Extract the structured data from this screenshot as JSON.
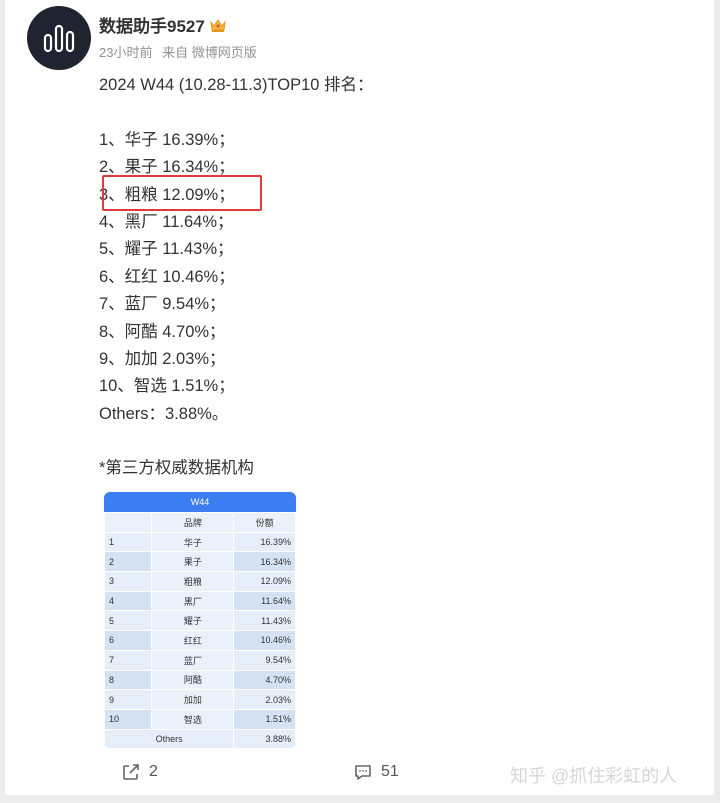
{
  "post": {
    "username": "数据助手9527",
    "meta": {
      "time": "23小时前",
      "source": "来自 微博网页版"
    },
    "heading": "2024 W44 (10.28-11.3)TOP10 排名：",
    "ranking_lines": [
      "1、华子 16.39%；",
      "2、果子 16.34%；",
      "3、粗粮 12.09%；",
      "4、黑厂 11.64%；",
      "5、耀子 11.43%；",
      "6、红红 10.46%；",
      "7、蓝厂 9.54%；",
      "8、阿酷 4.70%；",
      "9、加加 2.03%；",
      "10、智选 1.51%；",
      "Others：3.88%。"
    ],
    "note": "*第三方权威数据机构"
  },
  "table": {
    "title": "W44",
    "headers": [
      "",
      "品牌",
      "份额"
    ],
    "rows": [
      [
        "1",
        "华子",
        "16.39%"
      ],
      [
        "2",
        "果子",
        "16.34%"
      ],
      [
        "3",
        "粗粮",
        "12.09%"
      ],
      [
        "4",
        "黑厂",
        "11.64%"
      ],
      [
        "5",
        "耀子",
        "11.43%"
      ],
      [
        "6",
        "红红",
        "10.46%"
      ],
      [
        "7",
        "蓝厂",
        "9.54%"
      ],
      [
        "8",
        "阿酷",
        "4.70%"
      ],
      [
        "9",
        "加加",
        "2.03%"
      ],
      [
        "10",
        "智选",
        "1.51%"
      ]
    ],
    "others_label": "Others",
    "others_value": "3.88%"
  },
  "footer": {
    "share_count": "2",
    "comment_count": "51",
    "watermark": "知乎 @抓住彩虹的人"
  },
  "colors": {
    "highlight": "#e03a3a",
    "table_header": "#3d7df2",
    "avatar_bg": "#1f2430"
  },
  "icons": {
    "avatar": "bar-chart-logo",
    "badge": "crown-icon",
    "share": "share-icon",
    "comment": "comment-icon"
  }
}
